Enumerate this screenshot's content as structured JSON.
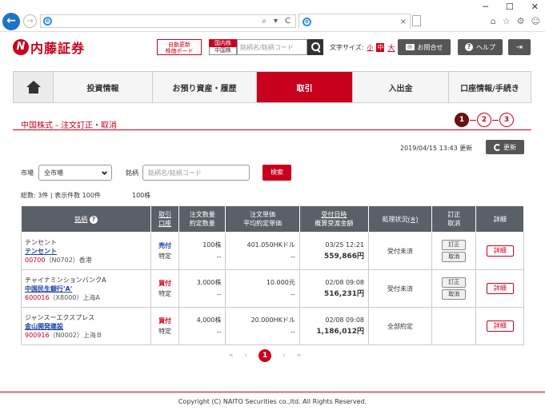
{
  "browser": {
    "min": "─",
    "max": "☐",
    "close": "✕",
    "back": "←",
    "fwd": "→",
    "addr_icons": [
      "⌕",
      "▾",
      "C"
    ],
    "tab_close": "×",
    "right_icons": [
      "⌂",
      "☆",
      "⚙",
      "☺"
    ]
  },
  "header": {
    "logo_mark": "N",
    "logo_text": "内藤証券",
    "auto_update": [
      "自動更新",
      "株価ボード"
    ],
    "market_top": "国内株",
    "market_bot": "中国株",
    "search_placeholder": "銘柄名/銘柄コード",
    "font_size_label": "文字サイズ:",
    "font_small": "小",
    "font_mid": "中",
    "font_large": "大",
    "contact": "お問合せ",
    "help": "ヘルプ",
    "help_mark": "?"
  },
  "nav": {
    "items": [
      "投資情報",
      "お預り資産・履歴",
      "取引",
      "入出金",
      "口座情報/手続き"
    ],
    "active": 2
  },
  "page": {
    "title": "中国株式 - 注文訂正・取消",
    "steps": [
      "1",
      "2",
      "3"
    ],
    "updated_at": "2019/04/15 13:43 更新",
    "refresh": "更新"
  },
  "filter": {
    "market_label": "市場",
    "market_value": "全市場",
    "issue_label": "銘柄",
    "issue_placeholder": "銘柄名/銘柄コード",
    "search": "検索"
  },
  "summary": {
    "count": "総数: 3件 | 表示件数 100件",
    "extra": "100株"
  },
  "table": {
    "headers": {
      "name": "銘柄",
      "help_mark": "?",
      "side": [
        "取引",
        "口座"
      ],
      "qty": [
        "注文数量",
        "約定数量"
      ],
      "price": [
        "注文単価",
        "平均約定単価"
      ],
      "date": [
        "受付日時",
        "概算受渡金額"
      ],
      "status": "処理状況",
      "status_note": "(※)",
      "mod": [
        "訂正",
        "取消"
      ],
      "detail": "詳細"
    },
    "rows": [
      {
        "kana": "テンセント",
        "name": "テンセント",
        "code": "00700",
        "sub": "（N0702）香港",
        "side": "売付",
        "side_type": "sell",
        "account": "特定",
        "qty": "100株",
        "filled": "--",
        "price": "401.050HKドル",
        "avg": "--",
        "date": "03/25 12:21",
        "amount": "559,866円",
        "status": "受付未済",
        "can_modify": true,
        "modify": "訂正",
        "cancel": "取消",
        "detail": "詳細"
      },
      {
        "kana": "チャイナミンションバンクA",
        "name": "中国民生銀行'A'",
        "code": "600016",
        "sub": "（X8000）上海A",
        "side": "買付",
        "side_type": "buy",
        "account": "特定",
        "qty": "3,000株",
        "filled": "--",
        "price": "10.000元",
        "avg": "--",
        "date": "02/08 09:08",
        "amount": "516,231円",
        "status": "受付未済",
        "can_modify": true,
        "modify": "訂正",
        "cancel": "取消",
        "detail": "詳細"
      },
      {
        "kana": "ジャンスーエクスプレス",
        "name": "金山開発建設",
        "code": "900916",
        "sub": "（N0002）上海Ｂ",
        "side": "買付",
        "side_type": "buy",
        "account": "特定",
        "qty": "4,000株",
        "filled": "--",
        "price": "20.000HKドル",
        "avg": "--",
        "date": "02/08 09:08",
        "amount": "1,186,012円",
        "status": "全部約定",
        "can_modify": false,
        "modify": "",
        "cancel": "",
        "detail": "詳細"
      }
    ]
  },
  "pager": {
    "first": "«",
    "prev": "‹",
    "current": "1",
    "next": "›",
    "last": "»"
  },
  "footer": {
    "copyright": "Copyright (C) NAITO Securities co.,ltd. All Rights Reserved."
  }
}
